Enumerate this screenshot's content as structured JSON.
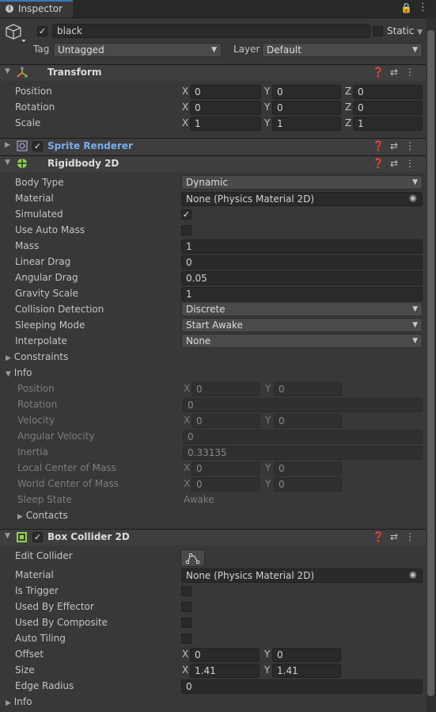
{
  "window": {
    "tab_label": "Inspector"
  },
  "gameobject": {
    "name": "black",
    "static_label": "Static",
    "tag_label": "Tag",
    "tag_value": "Untagged",
    "layer_label": "Layer",
    "layer_value": "Default"
  },
  "transform": {
    "title": "Transform",
    "rows": [
      {
        "label": "Position",
        "x": "0",
        "y": "0",
        "z": "0"
      },
      {
        "label": "Rotation",
        "x": "0",
        "y": "0",
        "z": "0"
      },
      {
        "label": "Scale",
        "x": "1",
        "y": "1",
        "z": "1"
      }
    ]
  },
  "sprite_renderer": {
    "title": "Sprite Renderer"
  },
  "rigidbody": {
    "title": "Rigidbody 2D",
    "body_type_label": "Body Type",
    "body_type": "Dynamic",
    "material_label": "Material",
    "material": "None (Physics Material 2D)",
    "simulated_label": "Simulated",
    "auto_mass_label": "Use Auto Mass",
    "mass_label": "Mass",
    "mass": "1",
    "linear_drag_label": "Linear Drag",
    "linear_drag": "0",
    "angular_drag_label": "Angular Drag",
    "angular_drag": "0.05",
    "gravity_label": "Gravity Scale",
    "gravity": "1",
    "collision_label": "Collision Detection",
    "collision": "Discrete",
    "sleeping_label": "Sleeping Mode",
    "sleeping": "Start Awake",
    "interpolate_label": "Interpolate",
    "interpolate": "None",
    "constraints_label": "Constraints",
    "info_label": "Info",
    "info": {
      "position_label": "Position",
      "position_x": "0",
      "position_y": "0",
      "rotation_label": "Rotation",
      "rotation": "0",
      "velocity_label": "Velocity",
      "velocity_x": "0",
      "velocity_y": "0",
      "angular_velocity_label": "Angular Velocity",
      "angular_velocity": "0",
      "inertia_label": "Inertia",
      "inertia": "0.33135",
      "local_com_label": "Local Center of Mass",
      "local_com_x": "0",
      "local_com_y": "0",
      "world_com_label": "World Center of Mass",
      "world_com_x": "0",
      "world_com_y": "0",
      "sleep_state_label": "Sleep State",
      "sleep_state": "Awake",
      "contacts_label": "Contacts"
    }
  },
  "box_collider": {
    "title": "Box Collider 2D",
    "edit_label": "Edit Collider",
    "material_label": "Material",
    "material": "None (Physics Material 2D)",
    "trigger_label": "Is Trigger",
    "effector_label": "Used By Effector",
    "composite_label": "Used By Composite",
    "auto_tiling_label": "Auto Tiling",
    "offset_label": "Offset",
    "offset_x": "0",
    "offset_y": "0",
    "size_label": "Size",
    "size_x": "1.41",
    "size_y": "1.41",
    "edge_radius_label": "Edge Radius",
    "edge_radius": "0",
    "info_label": "Info"
  },
  "axes": {
    "x": "X",
    "y": "Y",
    "z": "Z"
  },
  "colors": {
    "background": "#383838",
    "field": "#2a2a2a",
    "accent": "#3a79bb",
    "link": "#7aaef0"
  }
}
